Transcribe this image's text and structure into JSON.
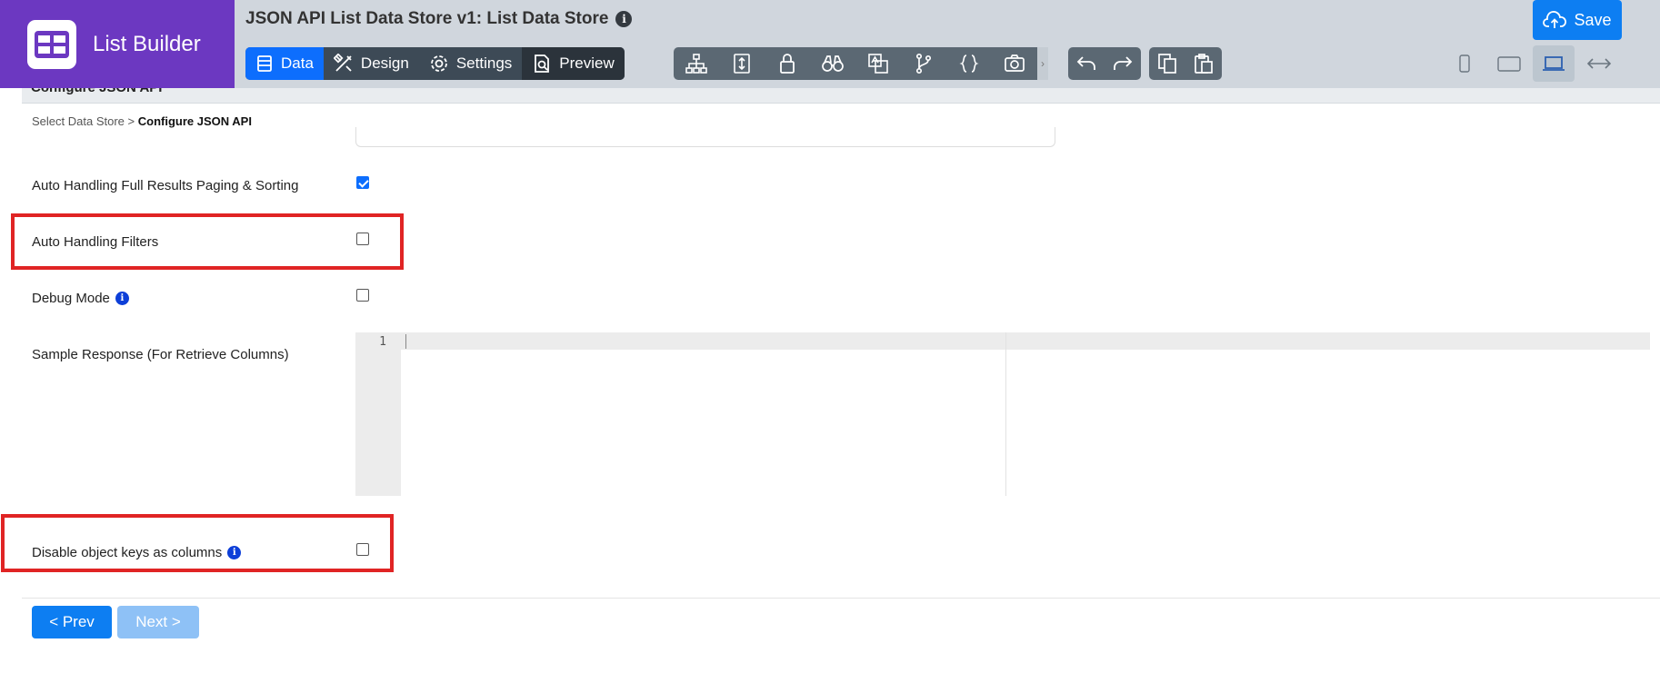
{
  "brand": {
    "name": "List Builder",
    "logo_icon": "grid-logo-icon"
  },
  "header": {
    "title": "JSON API List Data Store v1: List Data Store",
    "info_glyph": "i",
    "save_label": "Save",
    "tabs": [
      {
        "label": "Data",
        "icon": "data-icon",
        "active": true
      },
      {
        "label": "Design",
        "icon": "design-icon"
      },
      {
        "label": "Settings",
        "icon": "gear-icon"
      },
      {
        "label": "Preview",
        "icon": "preview-icon"
      }
    ],
    "scroll_glyph": "›",
    "colors": {
      "brand": "#6c38c1",
      "accent": "#0d6efd",
      "header_bg": "#d0d6dd"
    }
  },
  "section": {
    "title": "Configure JSON API",
    "breadcrumb": {
      "parent": "Select Data Store",
      "separator": ">",
      "current": "Configure JSON API"
    }
  },
  "form": {
    "paging_label": "Auto Handling Full Results Paging & Sorting",
    "paging_checked": true,
    "filters_label": "Auto Handling Filters",
    "filters_checked": false,
    "debug_label": "Debug Mode",
    "debug_checked": false,
    "sample_label": "Sample Response (For Retrieve Columns)",
    "editor_line_number": "1",
    "disable_keys_label": "Disable object keys as columns",
    "disable_keys_checked": false
  },
  "nav": {
    "prev_label": "< Prev",
    "next_label": "Next >"
  }
}
